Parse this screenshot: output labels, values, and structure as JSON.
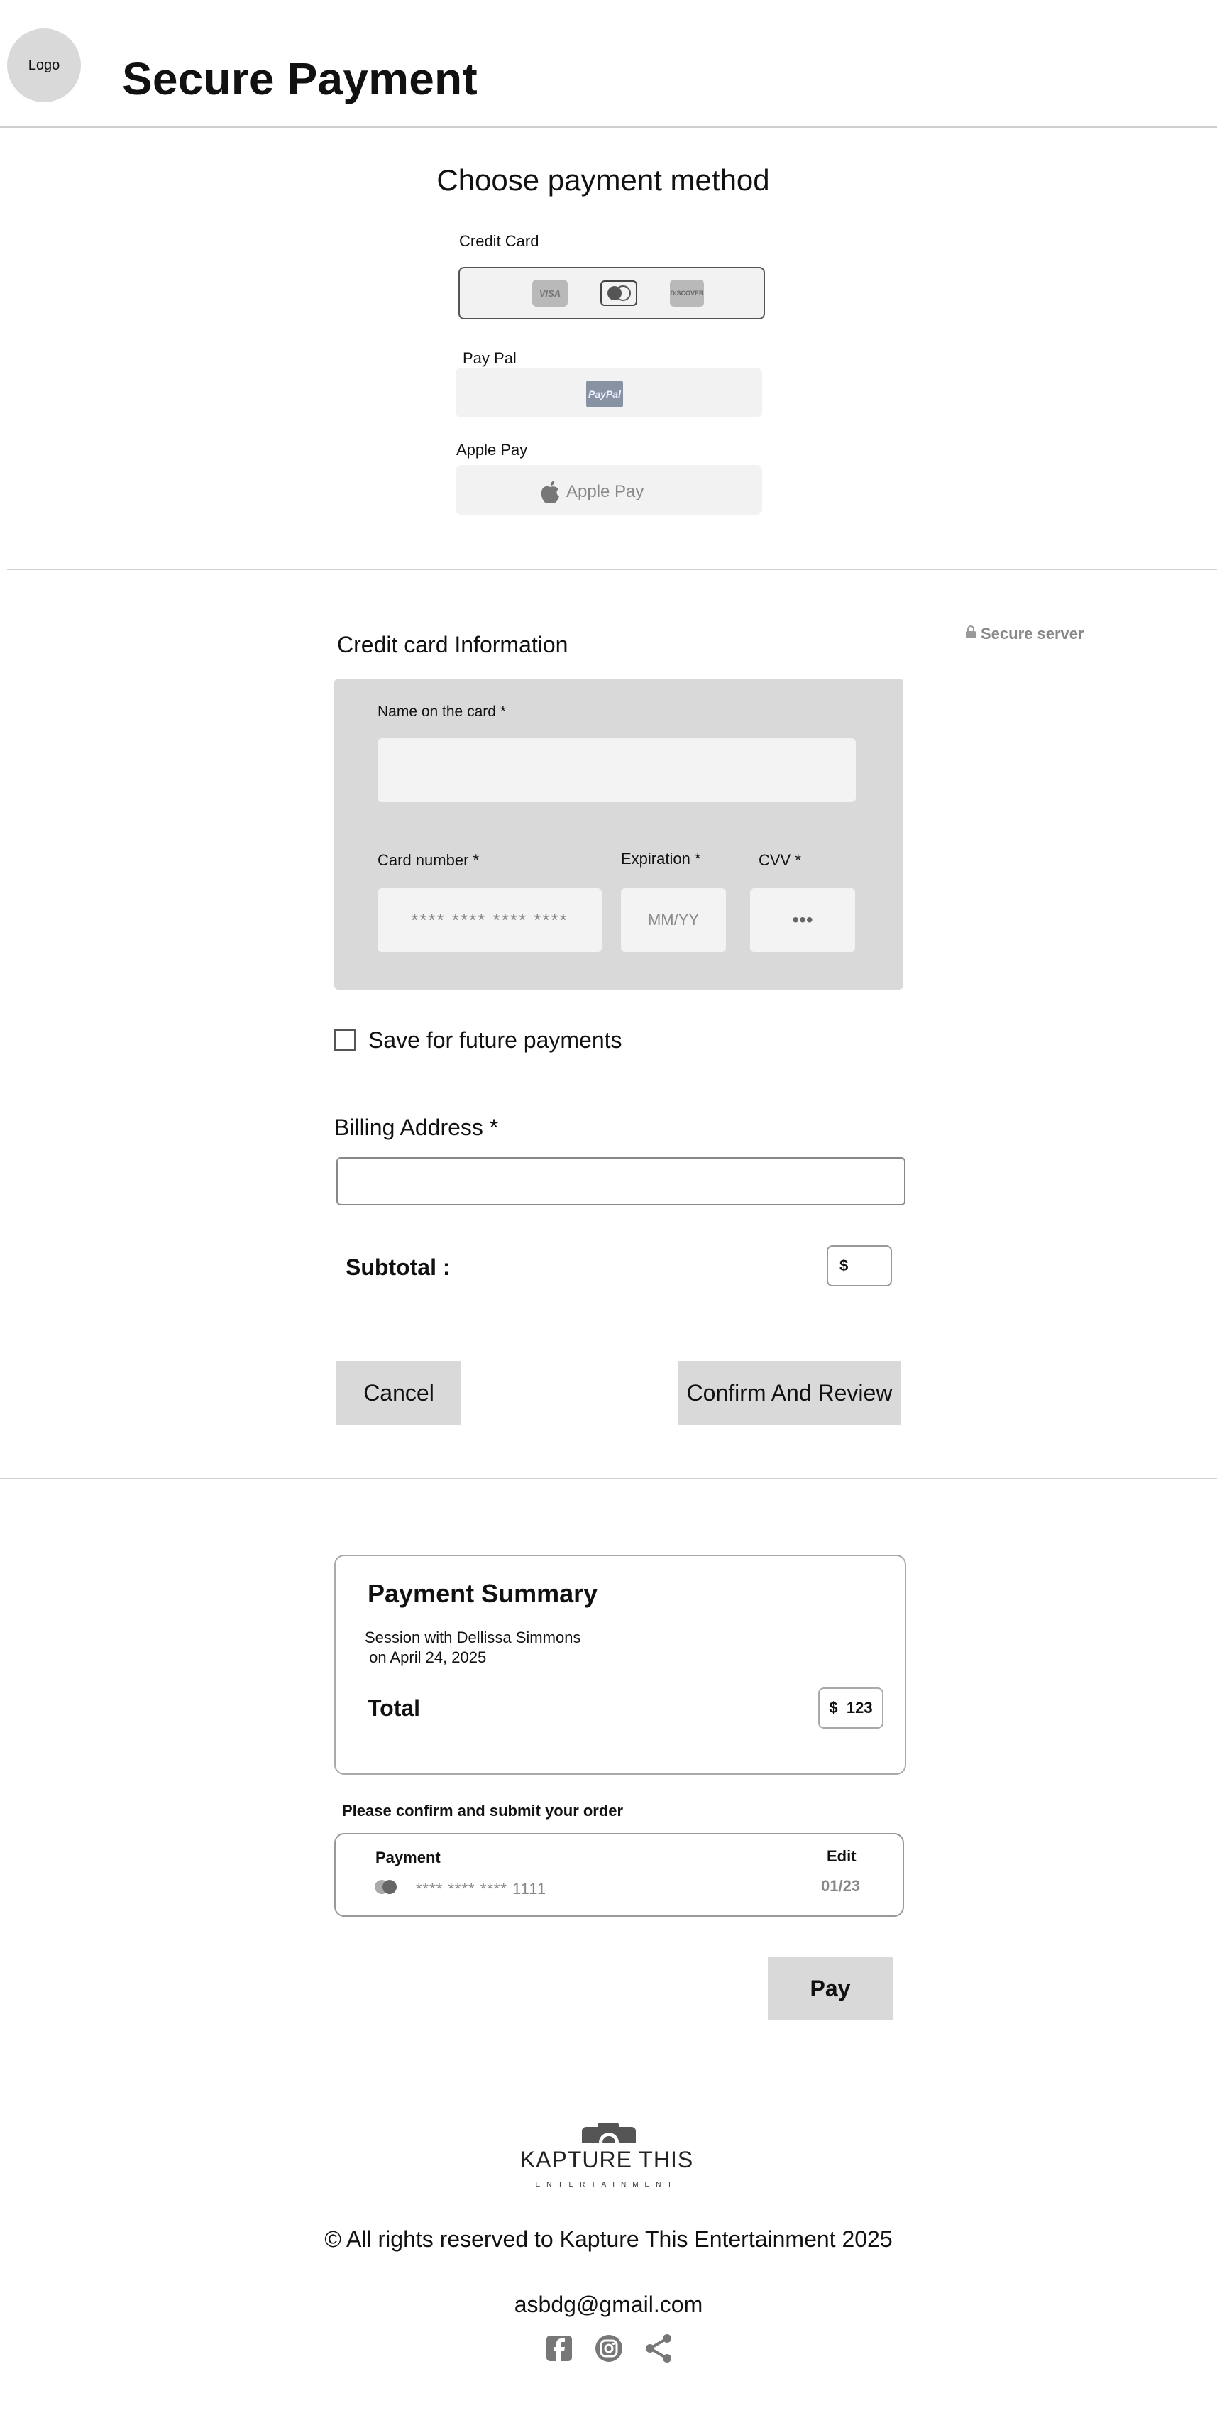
{
  "header": {
    "logo_label": "Logo",
    "title": "Secure Payment"
  },
  "payment_methods": {
    "title": "Choose payment method",
    "credit_card": {
      "label": "Credit Card",
      "cards": [
        "VISA",
        "DISCOVER"
      ]
    },
    "paypal": {
      "label": "Pay Pal",
      "badge": "PayPal"
    },
    "apple_pay": {
      "label": "Apple Pay",
      "button_text": "Apple Pay"
    }
  },
  "card_info": {
    "title": "Credit card Information",
    "secure_server": "Secure server",
    "name_label": "Name on the card *",
    "name_value": "",
    "number_label": "Card number  *",
    "number_placeholder": "**** **** **** ****",
    "expiration_label": "Expiration *",
    "expiration_placeholder": "MM/YY",
    "cvv_label": "CVV  *",
    "cvv_placeholder": "•••"
  },
  "save_checkbox": {
    "label": "Save for future payments",
    "checked": false
  },
  "billing": {
    "label": "Billing Address *",
    "value": ""
  },
  "subtotal": {
    "label": "Subtotal :",
    "value": "$"
  },
  "actions": {
    "cancel": "Cancel",
    "confirm": "Confirm And Review"
  },
  "summary": {
    "title": "Payment Summary",
    "session_line1": "Session with Dellissa Simmons",
    "session_line2": " on April 24, 2025",
    "total_label": "Total",
    "total_value": "$  123"
  },
  "confirm": {
    "prompt": "Please confirm and submit your order",
    "payment_label": "Payment",
    "edit_label": "Edit",
    "card_masked": "**** **** **** 1111",
    "expiry": "01/23",
    "pay_button": "Pay"
  },
  "footer": {
    "brand": "KAPTURE THIS",
    "brand_sub": "ENTERTAINMENT",
    "copyright": "© All rights reserved to Kapture This Entertainment 2025",
    "email": "asbdg@gmail.com",
    "icons": [
      "facebook-icon",
      "instagram-icon",
      "share-icon"
    ]
  },
  "colors": {
    "panel_gray": "#d9d9d9",
    "field_gray": "#f3f3f3",
    "divider": "#cfcfcf",
    "muted_text": "#888888"
  }
}
